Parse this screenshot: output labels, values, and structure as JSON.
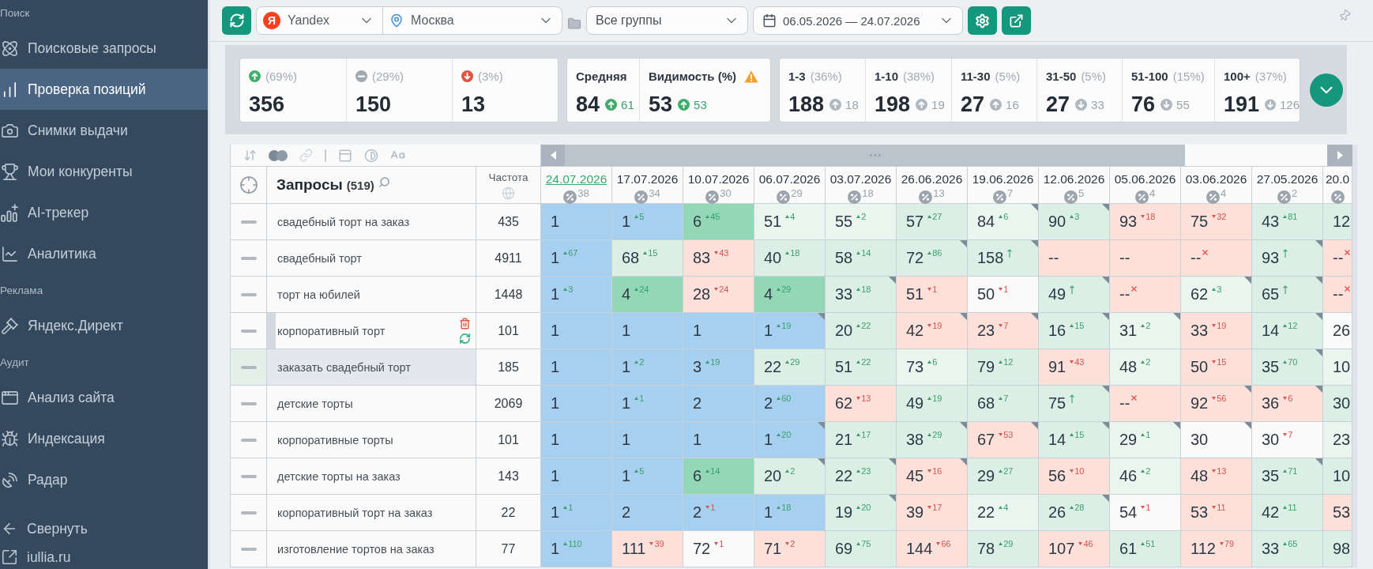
{
  "sidebar": {
    "sections": [
      {
        "title": "Поиск",
        "items": [
          {
            "label": "Поисковые запросы",
            "selected": false
          },
          {
            "label": "Проверка позиций",
            "selected": true
          },
          {
            "label": "Снимки выдачи",
            "selected": false
          },
          {
            "label": "Мои конкуренты",
            "selected": false
          },
          {
            "label": "AI-трекер",
            "selected": false
          },
          {
            "label": "Аналитика",
            "selected": false
          }
        ]
      },
      {
        "title": "Реклама",
        "items": [
          {
            "label": "Яндекс.Директ",
            "selected": false
          }
        ]
      },
      {
        "title": "Аудит",
        "items": [
          {
            "label": "Анализ сайта",
            "selected": false
          },
          {
            "label": "Индексация",
            "selected": false
          },
          {
            "label": "Радар",
            "selected": false
          }
        ]
      }
    ],
    "footer": [
      {
        "label": "Свернуть"
      },
      {
        "label": "iullia.ru"
      }
    ]
  },
  "toolbar": {
    "engine": {
      "logo": "Я",
      "name": "Yandex"
    },
    "region": "Москва",
    "group": "Все группы",
    "period": "06.05.2026 — 24.07.2026"
  },
  "summary": {
    "trend_cards": [
      {
        "kind": "up",
        "share": "(69%)",
        "count": "356"
      },
      {
        "kind": "same",
        "share": "(29%)",
        "count": "150"
      },
      {
        "kind": "down",
        "share": "(3%)",
        "count": "13"
      }
    ],
    "metrics": [
      {
        "label": "Средняя",
        "warning": false,
        "value": "84",
        "kind": "up",
        "change": "61"
      },
      {
        "label": "Видимость (%)",
        "warning": true,
        "value": "53",
        "kind": "up",
        "change": "53"
      }
    ],
    "ranges": [
      {
        "label": "1-3",
        "share": "(36%)",
        "count": "188",
        "kind": "up",
        "change": "18"
      },
      {
        "label": "1-10",
        "share": "(38%)",
        "count": "198",
        "kind": "up",
        "change": "19"
      },
      {
        "label": "11-30",
        "share": "(5%)",
        "count": "27",
        "kind": "up",
        "change": "16"
      },
      {
        "label": "31-50",
        "share": "(5%)",
        "count": "27",
        "kind": "down",
        "change": "33"
      },
      {
        "label": "51-100",
        "share": "(15%)",
        "count": "76",
        "kind": "down",
        "change": "55"
      },
      {
        "label": "100+",
        "share": "(37%)",
        "count": "191",
        "kind": "down",
        "change": "126"
      }
    ]
  },
  "table": {
    "query_column": {
      "title": "Запросы",
      "count": "(519)"
    },
    "frequency_column": "Частота",
    "dates": [
      {
        "date": "24.07.2026",
        "count": "38",
        "selected": true
      },
      {
        "date": "17.07.2026",
        "count": "34",
        "selected": false
      },
      {
        "date": "10.07.2026",
        "count": "30",
        "selected": false
      },
      {
        "date": "06.07.2026",
        "count": "29",
        "selected": false
      },
      {
        "date": "03.07.2026",
        "count": "18",
        "selected": false
      },
      {
        "date": "26.06.2026",
        "count": "13",
        "selected": false
      },
      {
        "date": "19.06.2026",
        "count": "7",
        "selected": false
      },
      {
        "date": "12.06.2026",
        "count": "5",
        "selected": false
      },
      {
        "date": "05.06.2026",
        "count": "4",
        "selected": false
      },
      {
        "date": "03.06.2026",
        "count": "4",
        "selected": false
      },
      {
        "date": "27.05.2026",
        "count": "2",
        "selected": false
      },
      {
        "date": "20.0",
        "selected": false
      }
    ],
    "rows": [
      {
        "query": "свадебный торт на заказ",
        "frequency": "435",
        "selected": false,
        "hovered": false,
        "cells": [
          {
            "value": "1",
            "kind": "none",
            "color": "#a6cff0",
            "flag": false
          },
          {
            "value": "1",
            "change": "5",
            "kind": "up",
            "color": "#a6cff0",
            "flag": false
          },
          {
            "value": "6",
            "change": "45",
            "kind": "up",
            "color": "#92d8b7",
            "flag": false
          },
          {
            "value": "51",
            "change": "4",
            "kind": "up",
            "color": "#eaf5f0",
            "flag": false
          },
          {
            "value": "55",
            "change": "2",
            "kind": "up",
            "color": "#eaf5f0",
            "flag": false
          },
          {
            "value": "57",
            "change": "27",
            "kind": "up",
            "color": "#dcefe6",
            "flag": false
          },
          {
            "value": "84",
            "change": "6",
            "kind": "up",
            "color": "#eaf5f0",
            "flag": true
          },
          {
            "value": "90",
            "change": "3",
            "kind": "up",
            "color": "#dcefe6",
            "flag": true
          },
          {
            "value": "93",
            "change": "18",
            "kind": "down",
            "color": "#fde0d9",
            "flag": false
          },
          {
            "value": "75",
            "change": "32",
            "kind": "down",
            "color": "#fde0d9",
            "flag": false
          },
          {
            "value": "43",
            "change": "81",
            "kind": "up",
            "color": "#dcefe6",
            "flag": false
          },
          {
            "value": "12",
            "kind": "none",
            "color": "#dcefe6",
            "flag": false
          }
        ]
      },
      {
        "query": "свадебный торт",
        "frequency": "4911",
        "selected": false,
        "hovered": false,
        "cells": [
          {
            "value": "1",
            "change": "67",
            "kind": "up",
            "color": "#a6cff0",
            "flag": false
          },
          {
            "value": "68",
            "change": "15",
            "kind": "up",
            "color": "#dcefe6",
            "flag": false
          },
          {
            "value": "83",
            "change": "43",
            "kind": "down",
            "color": "#fde0d9",
            "flag": false
          },
          {
            "value": "40",
            "change": "18",
            "kind": "up",
            "color": "#dcefe6",
            "flag": false
          },
          {
            "value": "58",
            "change": "14",
            "kind": "up",
            "color": "#dcefe6",
            "flag": false
          },
          {
            "value": "72",
            "change": "86",
            "kind": "up",
            "color": "#dcefe6",
            "flag": true
          },
          {
            "value": "158",
            "kind": "new",
            "color": "#dcefe6",
            "flag": true
          },
          {
            "value": "--",
            "kind": "none",
            "color": "#fde0d9",
            "flag": false
          },
          {
            "value": "--",
            "kind": "none",
            "color": "#fde0d9",
            "flag": false
          },
          {
            "value": "--",
            "kind": "out",
            "color": "#fde0d9",
            "flag": false
          },
          {
            "value": "93",
            "kind": "new",
            "color": "#dcefe6",
            "flag": true
          },
          {
            "value": "--",
            "kind": "out",
            "color": "#fde0d9",
            "flag": false
          }
        ]
      },
      {
        "query": "торт на юбилей",
        "frequency": "1448",
        "selected": false,
        "hovered": false,
        "cells": [
          {
            "value": "1",
            "change": "3",
            "kind": "up",
            "color": "#a6cff0",
            "flag": false
          },
          {
            "value": "4",
            "change": "24",
            "kind": "up",
            "color": "#92d8b7",
            "flag": false
          },
          {
            "value": "28",
            "change": "24",
            "kind": "down",
            "color": "#fde0d9",
            "flag": false
          },
          {
            "value": "4",
            "change": "29",
            "kind": "up",
            "color": "#92d8b7",
            "flag": false
          },
          {
            "value": "33",
            "change": "18",
            "kind": "up",
            "color": "#dcefe6",
            "flag": true
          },
          {
            "value": "51",
            "change": "1",
            "kind": "down",
            "color": "#fde0d9",
            "flag": false
          },
          {
            "value": "50",
            "change": "1",
            "kind": "down",
            "color": "#fafafa",
            "flag": false
          },
          {
            "value": "49",
            "kind": "new",
            "color": "#dcefe6",
            "flag": true
          },
          {
            "value": "--",
            "kind": "out",
            "color": "#fde0d9",
            "flag": false
          },
          {
            "value": "62",
            "change": "3",
            "kind": "up",
            "color": "#eaf5f0",
            "flag": true
          },
          {
            "value": "65",
            "kind": "new",
            "color": "#dcefe6",
            "flag": true
          },
          {
            "value": "--",
            "kind": "out",
            "color": "#fde0d9",
            "flag": false
          }
        ]
      },
      {
        "query": "корпоративный торт",
        "frequency": "101",
        "selected": false,
        "hovered": true,
        "cells": [
          {
            "value": "1",
            "kind": "none",
            "color": "#a6cff0",
            "flag": false
          },
          {
            "value": "1",
            "kind": "none",
            "color": "#a6cff0",
            "flag": false
          },
          {
            "value": "1",
            "kind": "none",
            "color": "#a6cff0",
            "flag": false
          },
          {
            "value": "1",
            "change": "19",
            "kind": "up",
            "color": "#a6cff0",
            "flag": true
          },
          {
            "value": "20",
            "change": "22",
            "kind": "up",
            "color": "#dcefe6",
            "flag": false
          },
          {
            "value": "42",
            "change": "19",
            "kind": "down",
            "color": "#fde0d9",
            "flag": true
          },
          {
            "value": "23",
            "change": "7",
            "kind": "down",
            "color": "#fde0d9",
            "flag": true
          },
          {
            "value": "16",
            "change": "15",
            "kind": "up",
            "color": "#dcefe6",
            "flag": true
          },
          {
            "value": "31",
            "change": "2",
            "kind": "up",
            "color": "#eaf5f0",
            "flag": true
          },
          {
            "value": "33",
            "change": "19",
            "kind": "down",
            "color": "#fde0d9",
            "flag": false
          },
          {
            "value": "14",
            "change": "12",
            "kind": "up",
            "color": "#dcefe6",
            "flag": true
          },
          {
            "value": "26",
            "kind": "none",
            "color": "#fafafa",
            "flag": false
          }
        ]
      },
      {
        "query": "заказать свадебный торт",
        "frequency": "185",
        "selected": true,
        "hovered": false,
        "cells": [
          {
            "value": "1",
            "kind": "none",
            "color": "#a6cff0",
            "flag": false
          },
          {
            "value": "1",
            "change": "2",
            "kind": "up",
            "color": "#a6cff0",
            "flag": false
          },
          {
            "value": "3",
            "change": "19",
            "kind": "up",
            "color": "#a6cff0",
            "flag": false
          },
          {
            "value": "22",
            "change": "29",
            "kind": "up",
            "color": "#dcefe6",
            "flag": false
          },
          {
            "value": "51",
            "change": "22",
            "kind": "up",
            "color": "#dcefe6",
            "flag": false
          },
          {
            "value": "73",
            "change": "6",
            "kind": "up",
            "color": "#eaf5f0",
            "flag": false
          },
          {
            "value": "79",
            "change": "12",
            "kind": "up",
            "color": "#dcefe6",
            "flag": false
          },
          {
            "value": "91",
            "change": "43",
            "kind": "down",
            "color": "#fde0d9",
            "flag": false
          },
          {
            "value": "48",
            "change": "2",
            "kind": "up",
            "color": "#eaf5f0",
            "flag": false
          },
          {
            "value": "50",
            "change": "15",
            "kind": "down",
            "color": "#fde0d9",
            "flag": false
          },
          {
            "value": "35",
            "change": "70",
            "kind": "up",
            "color": "#dcefe6",
            "flag": true
          },
          {
            "value": "10",
            "kind": "none",
            "color": "#eaf5f0",
            "flag": false
          }
        ]
      },
      {
        "query": "детские торты",
        "frequency": "2069",
        "selected": false,
        "hovered": false,
        "cells": [
          {
            "value": "1",
            "kind": "none",
            "color": "#a6cff0",
            "flag": false
          },
          {
            "value": "1",
            "change": "1",
            "kind": "up",
            "color": "#a6cff0",
            "flag": false
          },
          {
            "value": "2",
            "kind": "none",
            "color": "#a6cff0",
            "flag": false
          },
          {
            "value": "2",
            "change": "60",
            "kind": "up",
            "color": "#a6cff0",
            "flag": false
          },
          {
            "value": "62",
            "change": "13",
            "kind": "down",
            "color": "#fde0d9",
            "flag": false
          },
          {
            "value": "49",
            "change": "19",
            "kind": "up",
            "color": "#dcefe6",
            "flag": false
          },
          {
            "value": "68",
            "change": "7",
            "kind": "up",
            "color": "#dcefe6",
            "flag": false
          },
          {
            "value": "75",
            "kind": "new",
            "color": "#dcefe6",
            "flag": true
          },
          {
            "value": "--",
            "kind": "out",
            "color": "#fde0d9",
            "flag": false
          },
          {
            "value": "92",
            "change": "56",
            "kind": "down",
            "color": "#fde0d9",
            "flag": true
          },
          {
            "value": "36",
            "change": "6",
            "kind": "down",
            "color": "#fde0d9",
            "flag": true
          },
          {
            "value": "30",
            "kind": "none",
            "color": "#dcefe6",
            "flag": false
          }
        ]
      },
      {
        "query": "корпоративные торты",
        "frequency": "101",
        "selected": false,
        "hovered": false,
        "cells": [
          {
            "value": "1",
            "kind": "none",
            "color": "#a6cff0",
            "flag": false
          },
          {
            "value": "1",
            "kind": "none",
            "color": "#a6cff0",
            "flag": false
          },
          {
            "value": "1",
            "kind": "none",
            "color": "#a6cff0",
            "flag": false
          },
          {
            "value": "1",
            "change": "20",
            "kind": "up",
            "color": "#a6cff0",
            "flag": true
          },
          {
            "value": "21",
            "change": "17",
            "kind": "up",
            "color": "#dcefe6",
            "flag": false
          },
          {
            "value": "38",
            "change": "29",
            "kind": "up",
            "color": "#dcefe6",
            "flag": true
          },
          {
            "value": "67",
            "change": "53",
            "kind": "down",
            "color": "#fde0d9",
            "flag": true
          },
          {
            "value": "14",
            "change": "15",
            "kind": "up",
            "color": "#dcefe6",
            "flag": true
          },
          {
            "value": "29",
            "change": "1",
            "kind": "up",
            "color": "#eaf5f0",
            "flag": true
          },
          {
            "value": "30",
            "kind": "none",
            "color": "#fafafa",
            "flag": true
          },
          {
            "value": "30",
            "change": "7",
            "kind": "down",
            "color": "#fafafa",
            "flag": false
          },
          {
            "value": "23",
            "kind": "none",
            "color": "#eaf5f0",
            "flag": false
          }
        ]
      },
      {
        "query": "детские торты на заказ",
        "frequency": "143",
        "selected": false,
        "hovered": false,
        "cells": [
          {
            "value": "1",
            "kind": "none",
            "color": "#a6cff0",
            "flag": false
          },
          {
            "value": "1",
            "change": "5",
            "kind": "up",
            "color": "#a6cff0",
            "flag": false
          },
          {
            "value": "6",
            "change": "14",
            "kind": "up",
            "color": "#92d8b7",
            "flag": false
          },
          {
            "value": "20",
            "change": "2",
            "kind": "up",
            "color": "#dcefe6",
            "flag": true
          },
          {
            "value": "22",
            "change": "23",
            "kind": "up",
            "color": "#dcefe6",
            "flag": true
          },
          {
            "value": "45",
            "change": "16",
            "kind": "down",
            "color": "#fde0d9",
            "flag": true
          },
          {
            "value": "29",
            "change": "27",
            "kind": "up",
            "color": "#dcefe6",
            "flag": false
          },
          {
            "value": "56",
            "change": "10",
            "kind": "down",
            "color": "#fde0d9",
            "flag": false
          },
          {
            "value": "46",
            "change": "2",
            "kind": "up",
            "color": "#eaf5f0",
            "flag": false
          },
          {
            "value": "48",
            "change": "13",
            "kind": "down",
            "color": "#fde0d9",
            "flag": false
          },
          {
            "value": "35",
            "change": "71",
            "kind": "up",
            "color": "#dcefe6",
            "flag": true
          },
          {
            "value": "10",
            "kind": "none",
            "color": "#dcefe6",
            "flag": false
          }
        ]
      },
      {
        "query": "корпоративный торт на заказ",
        "frequency": "22",
        "selected": false,
        "hovered": false,
        "cells": [
          {
            "value": "1",
            "change": "1",
            "kind": "up",
            "color": "#a6cff0",
            "flag": false
          },
          {
            "value": "2",
            "kind": "none",
            "color": "#a6cff0",
            "flag": false
          },
          {
            "value": "2",
            "change": "1",
            "kind": "down",
            "color": "#a6cff0",
            "flag": false
          },
          {
            "value": "1",
            "change": "18",
            "kind": "up",
            "color": "#a6cff0",
            "flag": false
          },
          {
            "value": "19",
            "change": "20",
            "kind": "up",
            "color": "#dcefe6",
            "flag": true
          },
          {
            "value": "39",
            "change": "17",
            "kind": "down",
            "color": "#fde0d9",
            "flag": false
          },
          {
            "value": "22",
            "change": "4",
            "kind": "up",
            "color": "#eaf5f0",
            "flag": false
          },
          {
            "value": "26",
            "change": "28",
            "kind": "up",
            "color": "#dcefe6",
            "flag": true
          },
          {
            "value": "54",
            "change": "1",
            "kind": "down",
            "color": "#fafafa",
            "flag": false
          },
          {
            "value": "53",
            "change": "11",
            "kind": "down",
            "color": "#fde0d9",
            "flag": false
          },
          {
            "value": "42",
            "change": "11",
            "kind": "up",
            "color": "#dcefe6",
            "flag": false
          },
          {
            "value": "53",
            "kind": "none",
            "color": "#fde0d9",
            "flag": false
          }
        ]
      },
      {
        "query": "изготовление тортов на заказ",
        "frequency": "77",
        "selected": false,
        "hovered": false,
        "cells": [
          {
            "value": "1",
            "change": "110",
            "kind": "up",
            "color": "#a6cff0",
            "flag": false
          },
          {
            "value": "111",
            "change": "39",
            "kind": "down",
            "color": "#fde0d9",
            "flag": false
          },
          {
            "value": "72",
            "change": "1",
            "kind": "down",
            "color": "#fafafa",
            "flag": false
          },
          {
            "value": "71",
            "change": "2",
            "kind": "down",
            "color": "#fde0d9",
            "flag": false
          },
          {
            "value": "69",
            "change": "75",
            "kind": "up",
            "color": "#dcefe6",
            "flag": false
          },
          {
            "value": "144",
            "change": "66",
            "kind": "down",
            "color": "#fde0d9",
            "flag": false
          },
          {
            "value": "78",
            "change": "29",
            "kind": "up",
            "color": "#dcefe6",
            "flag": false
          },
          {
            "value": "107",
            "change": "46",
            "kind": "down",
            "color": "#fde0d9",
            "flag": false
          },
          {
            "value": "61",
            "change": "51",
            "kind": "up",
            "color": "#dcefe6",
            "flag": false
          },
          {
            "value": "112",
            "change": "79",
            "kind": "down",
            "color": "#fde0d9",
            "flag": false
          },
          {
            "value": "33",
            "change": "65",
            "kind": "up",
            "color": "#dcefe6",
            "flag": false
          },
          {
            "value": "98",
            "kind": "none",
            "color": "#dcefe6",
            "flag": false
          }
        ]
      }
    ]
  }
}
